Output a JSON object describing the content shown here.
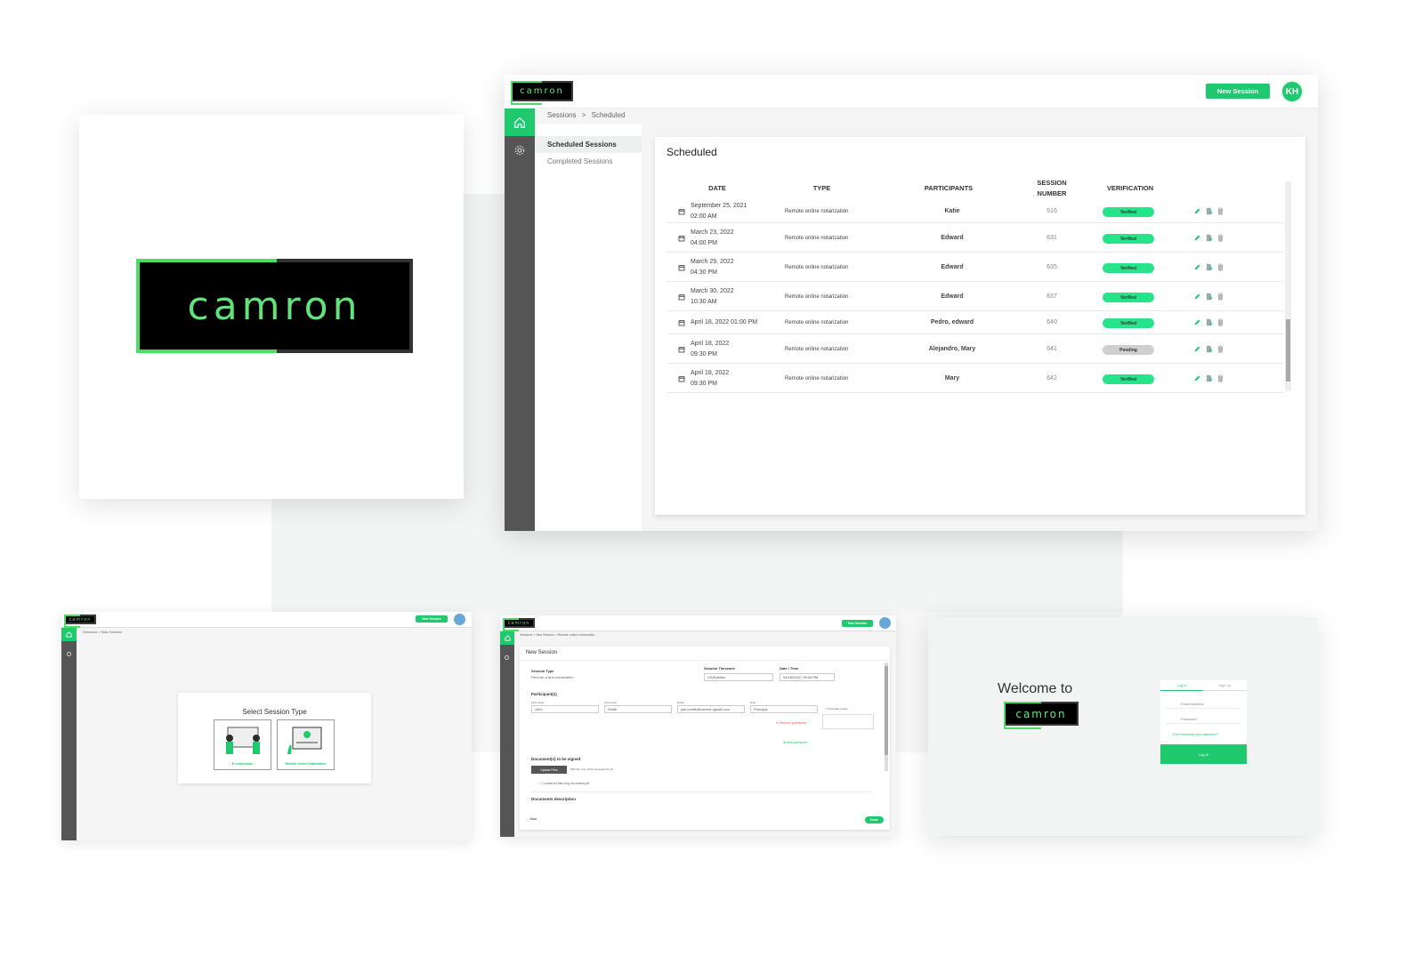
{
  "brand": {
    "logo_text": "camron",
    "accent": "#1fc96e",
    "logo_green": "#4ade62"
  },
  "main": {
    "new_session": "New Session",
    "avatar": "KH",
    "breadcrumb": [
      "Sessions",
      "Scheduled"
    ],
    "breadcrumb_sep": ">",
    "subnav": [
      "Scheduled Sessions",
      "Completed Sessions"
    ],
    "panel_title": "Scheduled",
    "columns": [
      "DATE",
      "TYPE",
      "PARTICIPANTS",
      "SESSION NUMBER",
      "VERIFICATION"
    ],
    "rows": [
      {
        "date": "September 25, 2021",
        "time": "02:00 AM",
        "type": "Remote online notarization",
        "participants": "Katie",
        "number": "516",
        "status": "Verified"
      },
      {
        "date": "March 23, 2022",
        "time": "04:00 PM",
        "type": "Remote online notarization",
        "participants": "Edward",
        "number": "631",
        "status": "Verified"
      },
      {
        "date": "March 29, 2022",
        "time": "04:30 PM",
        "type": "Remote online notarization",
        "participants": "Edward",
        "number": "635",
        "status": "Verified"
      },
      {
        "date": "March 30, 2022",
        "time": "10:30 AM",
        "type": "Remote online notarization",
        "participants": "Edward",
        "number": "637",
        "status": "Verified"
      },
      {
        "date": "April 18, 2022 01:00 PM",
        "time": "",
        "type": "Remote online notarization",
        "participants": "Pedro, edward",
        "number": "640",
        "status": "Verified"
      },
      {
        "date": "April 18, 2022",
        "time": "09:30 PM",
        "type": "Remote online notarization",
        "participants": "Alejandro, Mary",
        "number": "641",
        "status": "Pending"
      },
      {
        "date": "April 18, 2022",
        "time": "09:30 PM",
        "type": "Remote online notarization",
        "participants": "Mary",
        "number": "642",
        "status": "Verified"
      }
    ],
    "status_colors": {
      "Verified": "#27e38a",
      "Pending": "#cfcfcf"
    }
  },
  "select_screen": {
    "new_session": "New Session",
    "breadcrumb": "Sessions > New Session",
    "title": "Select Session Type",
    "options": [
      "E-notarization",
      "Remote Online Notarization"
    ]
  },
  "form_screen": {
    "new_session": "New Session",
    "breadcrumb": "Sessions > New Session > Remote online notarization",
    "title": "New Session",
    "session_type_label": "Session Type",
    "session_type_value": "Remote online notarization",
    "timezone_label": "Session Timezone",
    "timezone_value": "US/Eastern",
    "datetime_label": "Date / Time",
    "datetime_value": "04/18/2022, 09:00 PM",
    "participants_label": "Participant(s)",
    "first_name_label": "First name",
    "first_name": "John",
    "last_name_label": "Last name",
    "last_name": "Smith",
    "email_label": "Email",
    "email": "john.smith@camron.gmail.com",
    "role_label": "Role",
    "role": "Principal",
    "personally_known": "Personally known",
    "remove_participant": "Remove participant",
    "add_participant": "Add participant",
    "documents_label": "Document(s) to be signed",
    "upload": "Upload Files",
    "upload_hint": "PDF file only, 10mb accepted 10 mb",
    "file_name": "Contrat for fast long document.pdf",
    "desc_label": "Documents description",
    "back": "Back",
    "done": "Done"
  },
  "login_screen": {
    "welcome": "Welcome to",
    "tabs": [
      "Log In",
      "Sign Up"
    ],
    "email_placeholder": "Email Address",
    "password_placeholder": "Password",
    "forgot": "Don't remember your password?",
    "login_button": "Log In"
  }
}
